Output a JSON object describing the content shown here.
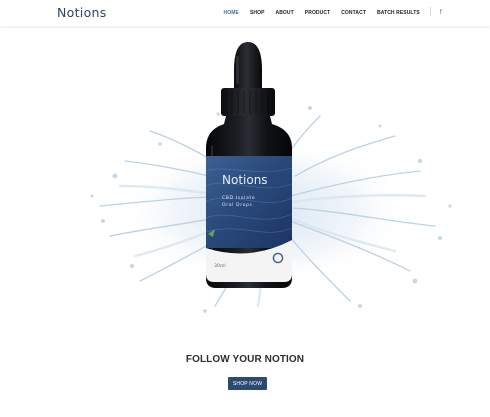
{
  "brand": {
    "logo_text": "Notions"
  },
  "nav": {
    "items": [
      {
        "label": "HOME",
        "active": true
      },
      {
        "label": "SHOP",
        "active": false
      },
      {
        "label": "ABOUT",
        "active": false
      },
      {
        "label": "PRODUCT",
        "active": false
      },
      {
        "label": "CONTACT",
        "active": false
      },
      {
        "label": "BATCH RESULTS",
        "active": false
      }
    ],
    "social_icon": "f"
  },
  "product": {
    "label_brand": "Notions",
    "label_line1": "CBD Isolate",
    "label_line2": "Oral Drops",
    "label_volume": "30ml",
    "label_badge": "O"
  },
  "hero": {
    "headline": "FOLLOW YOUR NOTION",
    "cta_label": "SHOP NOW"
  },
  "colors": {
    "accent": "#2c4b73",
    "logo": "#2c4561",
    "active_nav": "#3e6fa3"
  }
}
